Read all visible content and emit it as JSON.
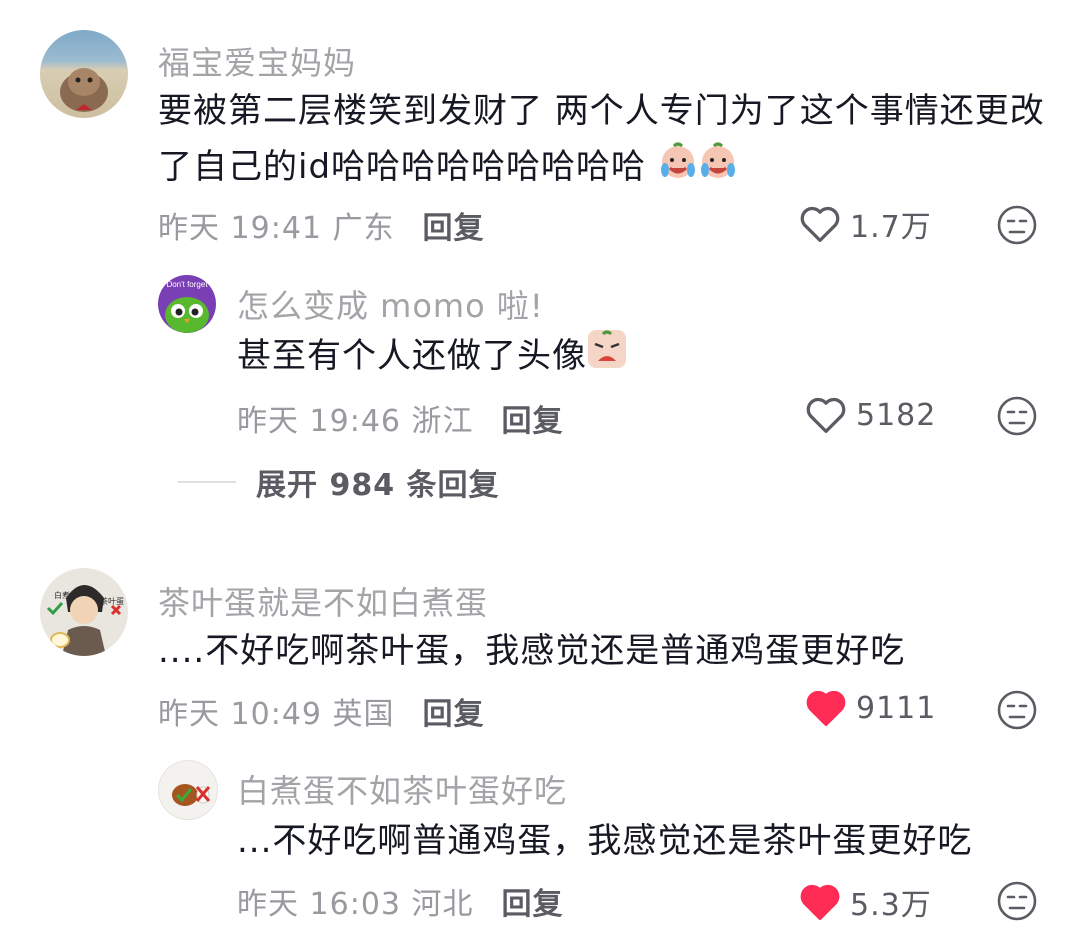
{
  "comments": [
    {
      "username": "福宝爱宝妈妈",
      "line1": "要被第二层楼笑到发财了 两个人专门为了这个事情还更改",
      "line2": "了自己的id哈哈哈哈哈哈哈哈哈",
      "meta": "昨天 19:41 广东",
      "reply_label": "回复",
      "likes": "1.7万",
      "liked": false
    },
    {
      "username": "怎么变成 momo 啦!",
      "line1": "甚至有个人还做了头像",
      "meta": "昨天 19:46 浙江",
      "reply_label": "回复",
      "likes": "5182",
      "liked": false,
      "avatar_text": "Don't forget"
    },
    {
      "username": "茶叶蛋就是不如白煮蛋",
      "line1": "....不好吃啊茶叶蛋，我感觉还是普通鸡蛋更好吃",
      "meta": "昨天 10:49 英国",
      "reply_label": "回复",
      "likes": "9111",
      "liked": true,
      "avatar_left": "白煮蛋",
      "avatar_right": "茶叶蛋"
    },
    {
      "username": "白煮蛋不如茶叶蛋好吃",
      "line1": "...不好吃啊普通鸡蛋，我感觉还是茶叶蛋更好吃",
      "meta": "昨天 16:03 河北",
      "reply_label": "回复",
      "likes": "5.3万",
      "liked": true
    }
  ],
  "expand_label": "展开 984 条回复",
  "icons": {
    "like_outline": "heart-outline-icon",
    "like_filled": "heart-filled-icon",
    "dislike": "neutral-face-icon"
  },
  "colors": {
    "liked": "#fe2c55",
    "username": "#a3a3a8",
    "meta": "#999aa0"
  }
}
